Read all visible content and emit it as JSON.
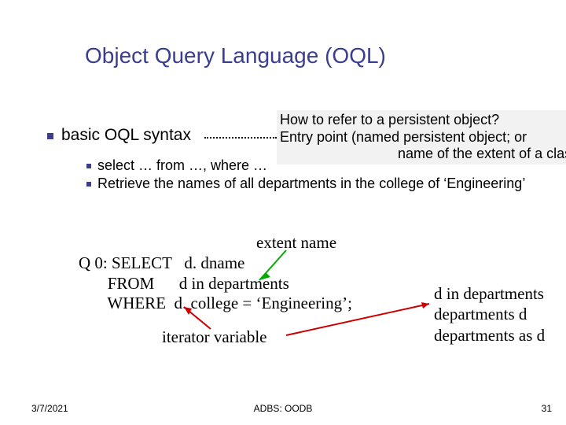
{
  "title": "Object Query Language (OQL)",
  "bullet1": "basic OQL syntax",
  "sub1": "select … from …, where …",
  "sub2": "Retrieve the names of all departments in the college of ‘Engineering’",
  "callout": {
    "l1": "How to refer to a persistent object?",
    "l2": "Entry point (named persistent object; or",
    "l3": "name of the extent of a class"
  },
  "extent": "extent name",
  "q0line1": "Q 0: SELECT   d. dname",
  "q0line2": "       FROM      d in departments",
  "q0line3": "       WHERE  d. college = ‘Engineering’;",
  "iter": "iterator variable",
  "alt1": "d in departments",
  "alt2": "departments d",
  "alt3": "departments as d",
  "footer": {
    "date": "3/7/2021",
    "center": "ADBS: OODB",
    "page": "31"
  }
}
